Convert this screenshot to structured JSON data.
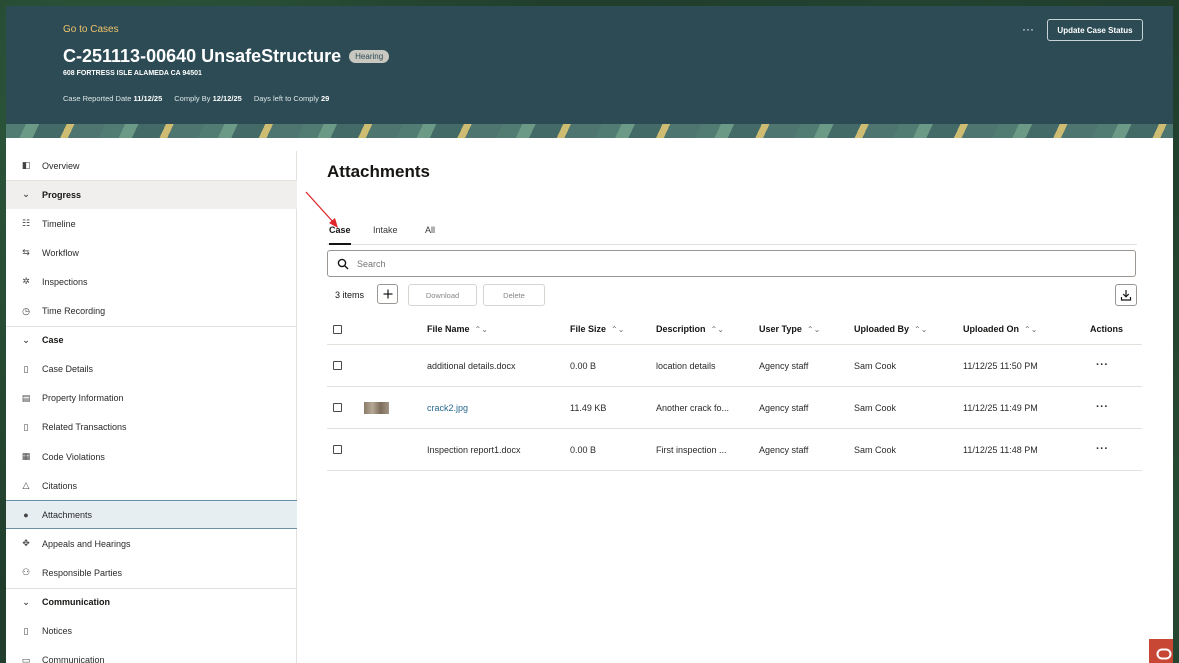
{
  "header": {
    "back_link": "Go to Cases",
    "case_title": "C-251113-00640 UnsafeStructure",
    "status_badge": "Hearing",
    "address": "608 FORTRESS ISLE ALAMEDA CA 94501",
    "meta": {
      "reported_label": "Case Reported Date",
      "reported_value": "11/12/25",
      "comply_label": "Comply By",
      "comply_value": "12/12/25",
      "days_label": "Days left to Comply",
      "days_value": "29"
    },
    "more_label": "···",
    "update_button": "Update Case Status"
  },
  "sidebar": {
    "items": [
      {
        "label": "Overview",
        "icon": "overview-icon",
        "glyph": "◧"
      },
      {
        "label": "Progress",
        "icon": "chevron-down-icon",
        "glyph": "⌄",
        "section": true
      },
      {
        "label": "Timeline",
        "icon": "timeline-icon",
        "glyph": "☷"
      },
      {
        "label": "Workflow",
        "icon": "workflow-icon",
        "glyph": "⇆"
      },
      {
        "label": "Inspections",
        "icon": "inspections-icon",
        "glyph": "✲"
      },
      {
        "label": "Time Recording",
        "icon": "clock-icon",
        "glyph": "◷"
      },
      {
        "label": "Case",
        "icon": "chevron-down-icon",
        "glyph": "⌄",
        "section": true
      },
      {
        "label": "Case Details",
        "icon": "document-icon",
        "glyph": "▯"
      },
      {
        "label": "Property Information",
        "icon": "property-icon",
        "glyph": "▤"
      },
      {
        "label": "Related Transactions",
        "icon": "transactions-icon",
        "glyph": "▯"
      },
      {
        "label": "Code Violations",
        "icon": "violations-icon",
        "glyph": "▦"
      },
      {
        "label": "Citations",
        "icon": "warning-icon",
        "glyph": "△"
      },
      {
        "label": "Attachments",
        "icon": "attachment-icon",
        "glyph": "●"
      },
      {
        "label": "Appeals and Hearings",
        "icon": "appeals-icon",
        "glyph": "✥"
      },
      {
        "label": "Responsible Parties",
        "icon": "people-icon",
        "glyph": "⚇"
      },
      {
        "label": "Communication",
        "icon": "chevron-down-icon",
        "glyph": "⌄",
        "section": true
      },
      {
        "label": "Notices",
        "icon": "notices-icon",
        "glyph": "▯"
      },
      {
        "label": "Communication",
        "icon": "communication-icon",
        "glyph": "▭"
      }
    ]
  },
  "main": {
    "title": "Attachments",
    "tabs": [
      {
        "label": "Case",
        "active": true
      },
      {
        "label": "Intake",
        "active": false
      },
      {
        "label": "All",
        "active": false
      }
    ],
    "search_placeholder": "Search",
    "items_count": "3 items",
    "download_label": "Download",
    "delete_label": "Delete",
    "columns": [
      "File Name",
      "File Size",
      "Description",
      "User Type",
      "Uploaded By",
      "Uploaded On",
      "Actions"
    ],
    "rows": [
      {
        "file_name": "additional details.docx",
        "file_size": "0.00 B",
        "description": "location details",
        "user_type": "Agency staff",
        "uploaded_by": "Sam Cook",
        "uploaded_on": "11/12/25 11:50 PM",
        "actions": "···"
      },
      {
        "file_name": "crack2.jpg",
        "file_size": "11.49 KB",
        "description": "Another crack fo...",
        "user_type": "Agency staff",
        "uploaded_by": "Sam Cook",
        "uploaded_on": "11/12/25 11:49 PM",
        "actions": "···"
      },
      {
        "file_name": "Inspection report1.docx",
        "file_size": "0.00 B",
        "description": "First inspection ...",
        "user_type": "Agency staff",
        "uploaded_by": "Sam Cook",
        "uploaded_on": "11/12/25 11:48 PM",
        "actions": "···"
      }
    ]
  },
  "colors": {
    "header_bg": "#2c4b55",
    "back_link": "#f0c36a",
    "link": "#2a6a8e",
    "annotation_arrow": "#e0262a",
    "oracle_red": "#c74634"
  }
}
